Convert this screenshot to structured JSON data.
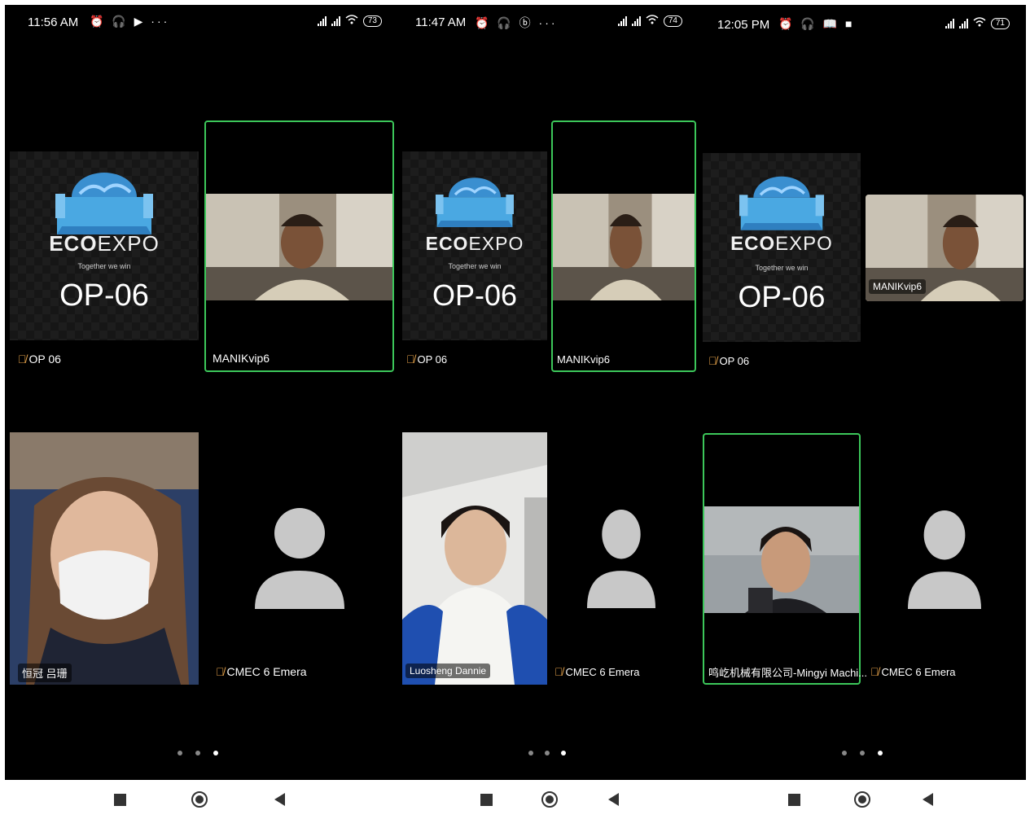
{
  "phones": [
    {
      "status": {
        "time": "11:56 AM",
        "icons": "⏰ 🎧 ▶ ···",
        "battery": "73"
      },
      "tiles": {
        "op": {
          "brand_a": "ECO",
          "brand_b": "EXPO",
          "tagline": "Together we win",
          "code": "OP-06",
          "label": "OP 06"
        },
        "manik": {
          "label": "MANIKvip6"
        },
        "third": {
          "label": "恒冠 吕珊"
        },
        "cmec": {
          "label": "CMEC 6 Emera"
        }
      }
    },
    {
      "status": {
        "time": "11:47 AM",
        "icons": "⏰ 🎧 ⓑ ···",
        "battery": "74"
      },
      "tiles": {
        "op": {
          "brand_a": "ECO",
          "brand_b": "EXPO",
          "tagline": "Together we win",
          "code": "OP-06",
          "label": "OP 06"
        },
        "manik": {
          "label": "MANIKvip6"
        },
        "third": {
          "label": "Luosheng Dannie"
        },
        "cmec": {
          "label": "CMEC 6 Emera"
        }
      }
    },
    {
      "status": {
        "time": "12:05 PM",
        "icons": "⏰ 🎧 📖 ■",
        "battery": "71"
      },
      "tiles": {
        "op": {
          "brand_a": "ECO",
          "brand_b": "EXPO",
          "tagline": "Together we win",
          "code": "OP-06",
          "label": "OP 06"
        },
        "manik": {
          "label": "MANIKvip6"
        },
        "third": {
          "label": "鸣屹机械有限公司-Mingyi Machi..."
        },
        "cmec": {
          "label": "CMEC 6 Emera"
        }
      }
    }
  ],
  "page_indicator": {
    "pages": 3,
    "current": 3
  },
  "nav_icons": [
    "recent-apps-icon",
    "home-icon",
    "back-icon"
  ],
  "colors": {
    "active_speaker_border": "#3cc75a",
    "muted_mic": "#e6a24a",
    "avatar": "#c8c8c8"
  }
}
